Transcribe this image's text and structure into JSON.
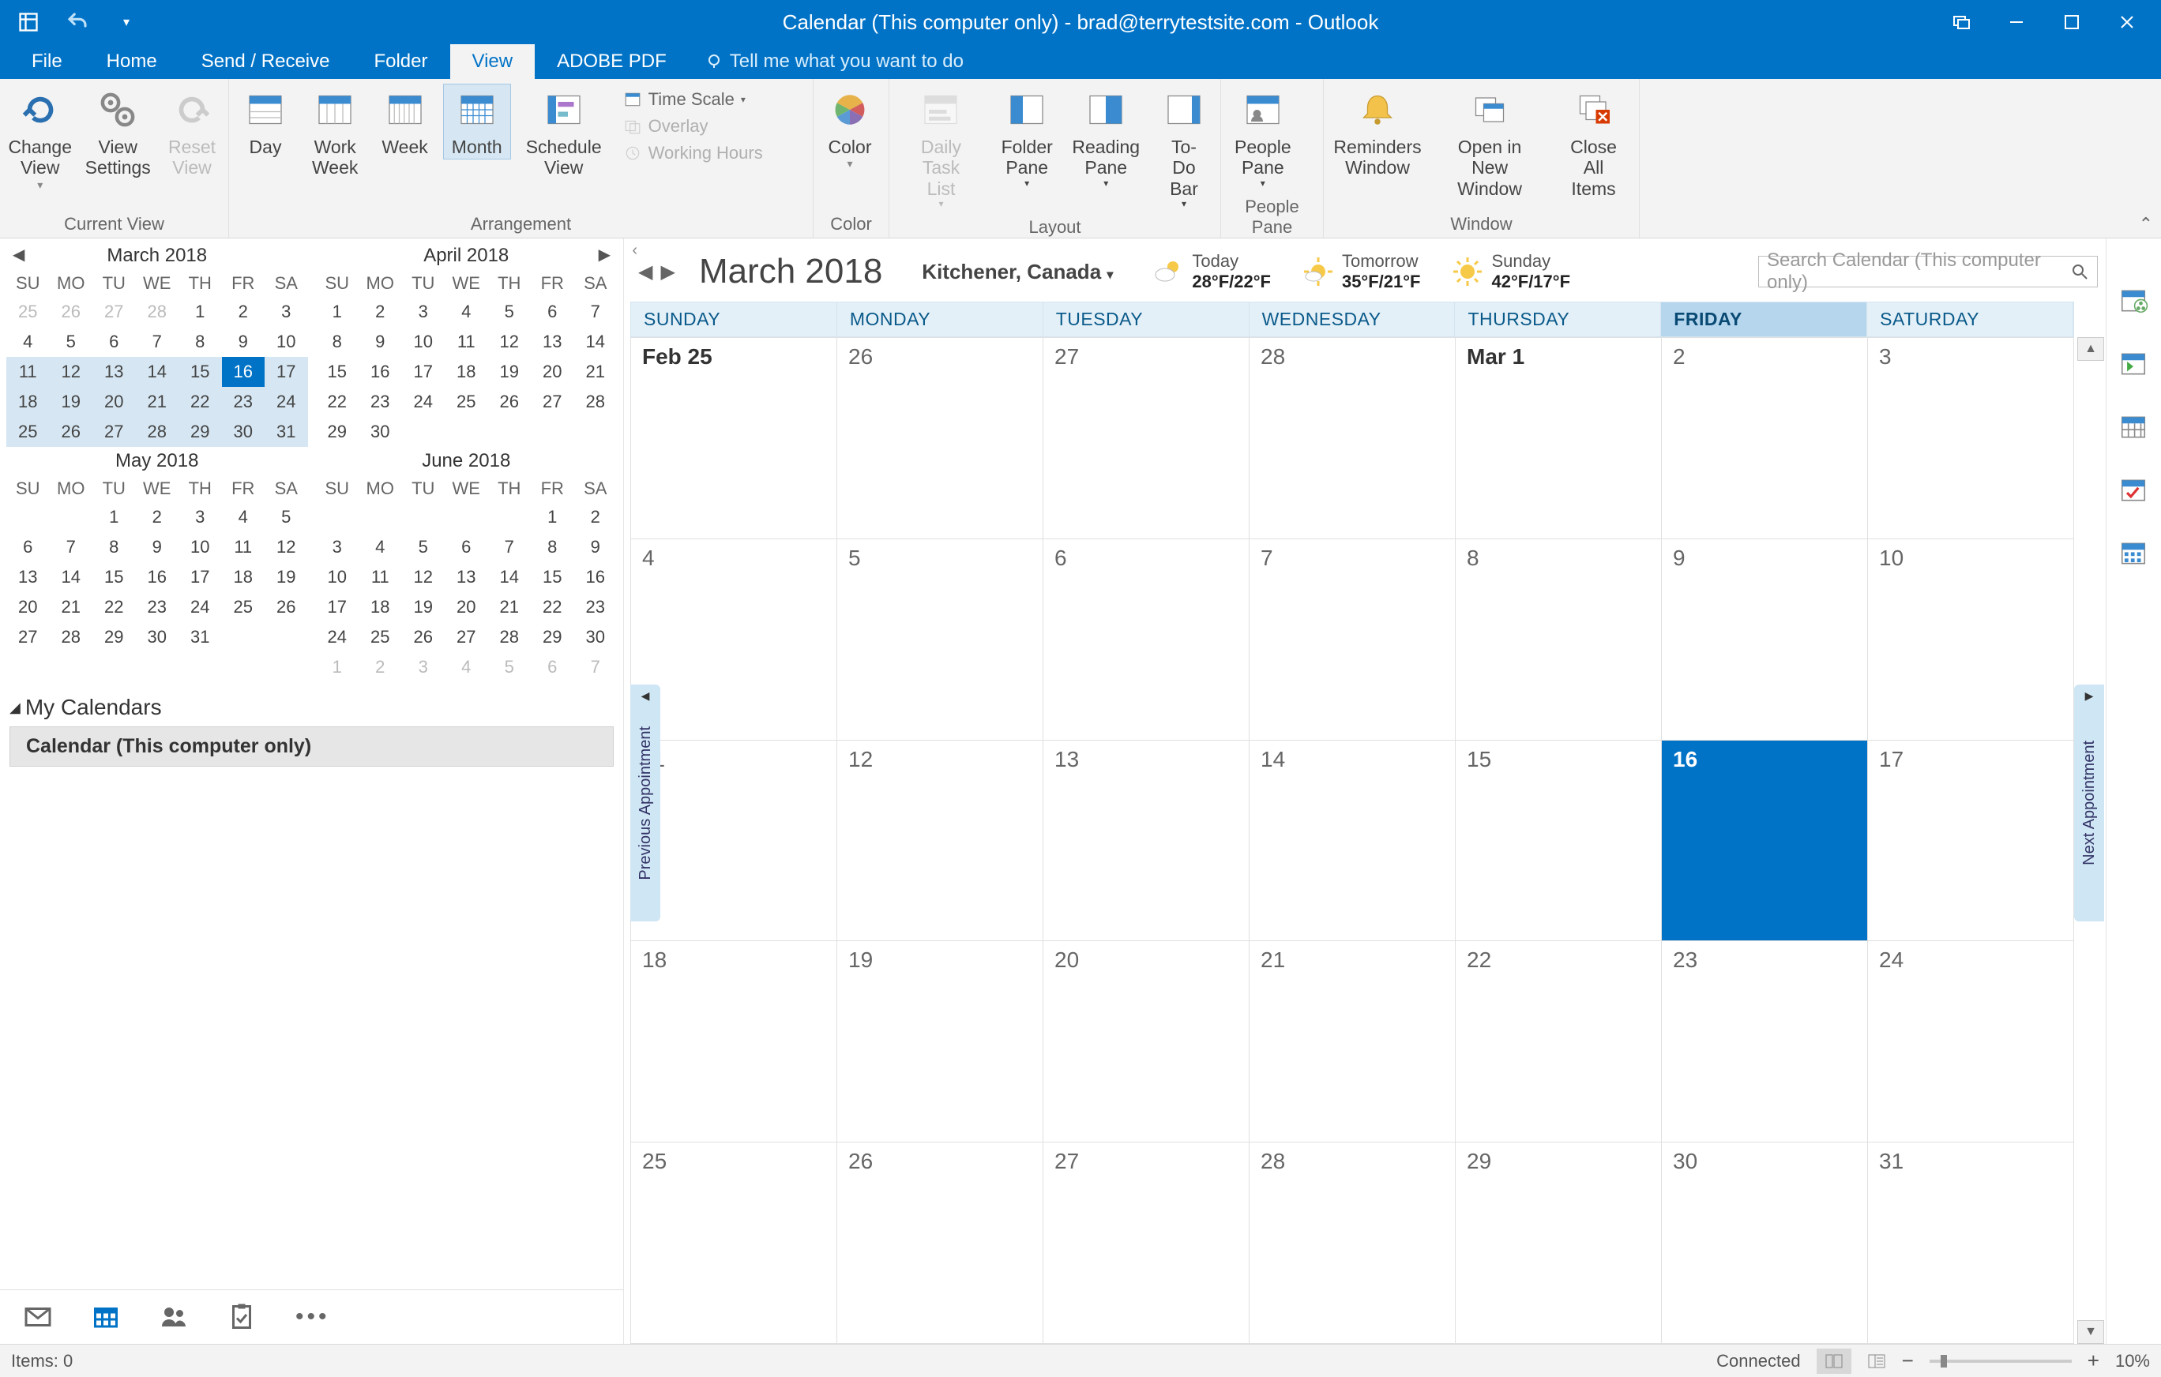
{
  "title": "Calendar (This computer only) - brad@terrytestsite.com  -  Outlook",
  "menu": {
    "file": "File",
    "home": "Home",
    "sendrecv": "Send / Receive",
    "folder": "Folder",
    "view": "View",
    "adobe": "ADOBE PDF",
    "tellme": "Tell me what you want to do"
  },
  "ribbon": {
    "groups": {
      "currentview": "Current View",
      "arrangement": "Arrangement",
      "color": "Color",
      "layout": "Layout",
      "peoplepane": "People Pane",
      "window": "Window"
    },
    "changeview": "Change\nView",
    "viewsettings": "View\nSettings",
    "resetview": "Reset\nView",
    "day": "Day",
    "workweek": "Work\nWeek",
    "week": "Week",
    "month": "Month",
    "schedule": "Schedule\nView",
    "timescale": "Time Scale",
    "overlay": "Overlay",
    "workinghours": "Working Hours",
    "colorbtn": "Color",
    "dailytask": "Daily Task\nList",
    "folderpane": "Folder\nPane",
    "readingpane": "Reading\nPane",
    "todobar": "To-Do\nBar",
    "peoplepanebtn": "People\nPane",
    "reminders": "Reminders\nWindow",
    "openinnew": "Open in New\nWindow",
    "closeall": "Close\nAll Items"
  },
  "minical": {
    "headers": [
      "SU",
      "MO",
      "TU",
      "WE",
      "TH",
      "FR",
      "SA"
    ],
    "months": [
      "March 2018",
      "April 2018",
      "May 2018",
      "June 2018"
    ]
  },
  "sidebar": {
    "mycals": "My Calendars",
    "cal1": "Calendar (This computer only)"
  },
  "calendar": {
    "title": "March 2018",
    "location": "Kitchener, Canada",
    "searchph": "Search Calendar (This computer only)",
    "weather": [
      {
        "label": "Today",
        "temp": "28°F/22°F"
      },
      {
        "label": "Tomorrow",
        "temp": "35°F/21°F"
      },
      {
        "label": "Sunday",
        "temp": "42°F/17°F"
      }
    ],
    "days": [
      "SUNDAY",
      "MONDAY",
      "TUESDAY",
      "WEDNESDAY",
      "THURSDAY",
      "FRIDAY",
      "SATURDAY"
    ],
    "cells": [
      "Feb 25",
      "26",
      "27",
      "28",
      "Mar 1",
      "2",
      "3",
      "4",
      "5",
      "6",
      "7",
      "8",
      "9",
      "10",
      "11",
      "12",
      "13",
      "14",
      "15",
      "16",
      "17",
      "18",
      "19",
      "20",
      "21",
      "22",
      "23",
      "24",
      "25",
      "26",
      "27",
      "28",
      "29",
      "30",
      "31"
    ],
    "prevappt": "Previous Appointment",
    "nextappt": "Next Appointment"
  },
  "status": {
    "items": "Items: 0",
    "connected": "Connected",
    "zoom": "10%"
  }
}
